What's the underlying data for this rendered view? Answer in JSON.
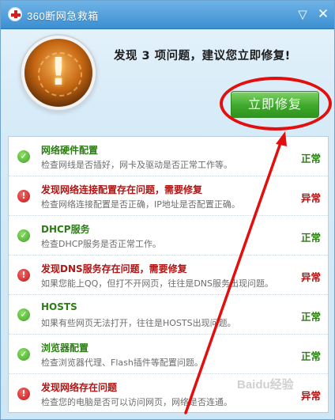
{
  "window": {
    "title": "360断网急救箱",
    "min_glyph": "▽",
    "close_glyph": "✕"
  },
  "header": {
    "alert_icon": "exclamation-alert-icon",
    "alert_glyph": "!",
    "headline": "发现 3 项问题，建议您立即修复!",
    "fix_button_label": "立即修复",
    "fix_button_color": "#3fa82b"
  },
  "annotation": {
    "color": "#e20f0f"
  },
  "watermark": "Baidu经验",
  "colors": {
    "ok": "#2b7d14",
    "error": "#b01515"
  },
  "checks": [
    {
      "title": "网络硬件配置",
      "desc": "检查网线是否插好，网卡及驱动是否正常工作等。",
      "status": "正常",
      "state": "ok",
      "icon": "check-icon",
      "glyph": "✓"
    },
    {
      "title": "发现网络连接配置存在问题，需要修复",
      "desc": "检查网络连接配置是否正确，IP地址是否配置正确。",
      "status": "异常",
      "state": "error",
      "icon": "exclamation-icon",
      "glyph": "!"
    },
    {
      "title": "DHCP服务",
      "desc": "检查DHCP服务是否正常工作。",
      "status": "正常",
      "state": "ok",
      "icon": "check-icon",
      "glyph": "✓"
    },
    {
      "title": "发现DNS服务存在问题，需要修复",
      "desc": "如果您能上QQ，但打不开网页，往往是DNS服务出现问题。",
      "status": "异常",
      "state": "error",
      "icon": "exclamation-icon",
      "glyph": "!"
    },
    {
      "title": "HOSTS",
      "desc": "如果有些网页无法打开，往往是HOSTS出现问题。",
      "status": "正常",
      "state": "ok",
      "icon": "check-icon",
      "glyph": "✓"
    },
    {
      "title": "浏览器配置",
      "desc": "检查浏览器代理、Flash插件等配置问题。",
      "status": "正常",
      "state": "ok",
      "icon": "check-icon",
      "glyph": "✓"
    },
    {
      "title": "发现网络存在问题",
      "desc": "检查您的电脑是否可以访问网页，网络是否连通。",
      "status": "异常",
      "state": "error",
      "icon": "exclamation-icon",
      "glyph": "!"
    }
  ]
}
